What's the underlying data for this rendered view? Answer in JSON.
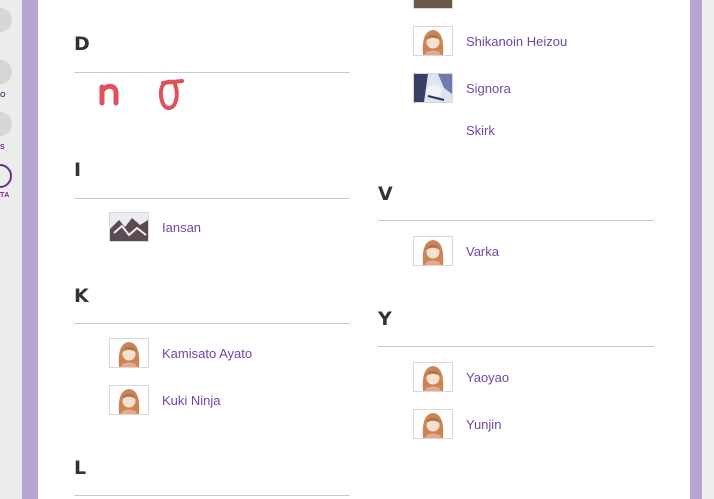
{
  "nav": {
    "labels": [
      "O",
      "S",
      "TA"
    ]
  },
  "sections": {
    "D": {
      "letter": "D"
    },
    "I": {
      "letter": "I",
      "items": [
        {
          "name": "Iansan",
          "thumb": "photo"
        }
      ]
    },
    "K": {
      "letter": "K",
      "items": [
        {
          "name": "Kamisato Ayato",
          "thumb": "avatar"
        },
        {
          "name": "Kuki Ninja",
          "thumb": "avatar"
        }
      ]
    },
    "L": {
      "letter": "L"
    },
    "S": {
      "items": [
        {
          "name": "Shikanoin Heizou",
          "thumb": "avatar"
        },
        {
          "name": "Signora",
          "thumb": "photo"
        },
        {
          "name": "Skirk",
          "thumb": "none"
        }
      ]
    },
    "V": {
      "letter": "V",
      "items": [
        {
          "name": "Varka",
          "thumb": "avatar"
        }
      ]
    },
    "Y": {
      "letter": "Y",
      "items": [
        {
          "name": "Yaoyao",
          "thumb": "avatar"
        },
        {
          "name": "Yunjin",
          "thumb": "avatar"
        }
      ]
    }
  },
  "colors": {
    "link": "#7046a3",
    "heading": "#333333",
    "background_frame": "#b6a6cf",
    "doodle": "#e0505a"
  }
}
